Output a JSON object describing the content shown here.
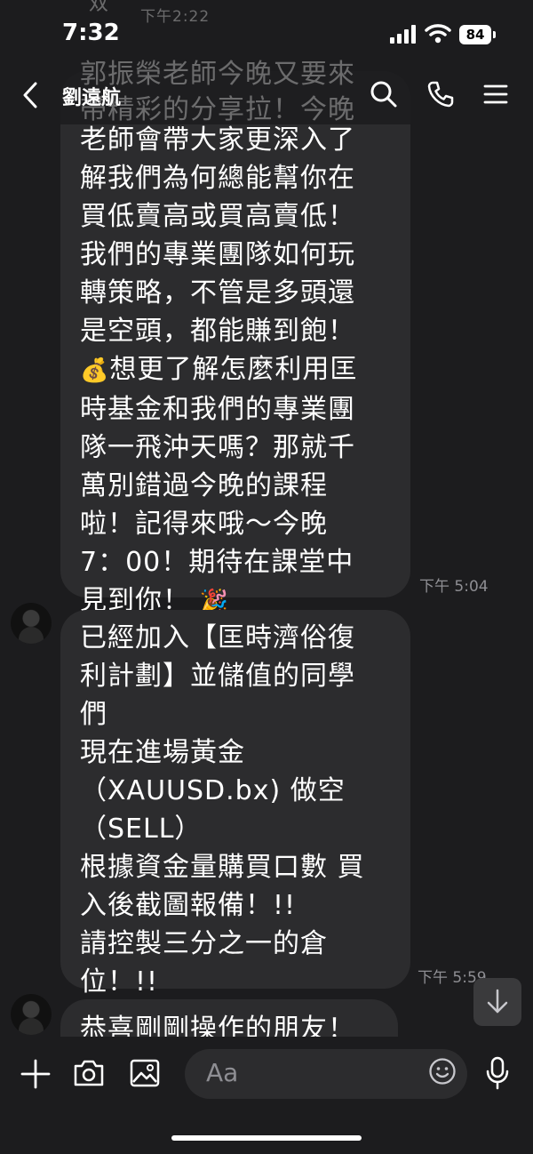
{
  "status_bar": {
    "time": "7:32",
    "battery": "84"
  },
  "header": {
    "title": "劉遠航",
    "overlay_text_1": "郭振榮老師今晚又要來",
    "overlay_text_2": "帶精彩的分享拉！今晚",
    "overlay_top_time": "下午2:22",
    "overlay_top_name": "双"
  },
  "messages": [
    {
      "text_before_emoji": "老師會帶大家更深入了\n解我們為何總能幫你在\n買低賣高或買高賣低！\n我們的專業團隊如何玩\n轉策略，不管是多頭還\n是空頭，都能賺到飽！\n",
      "emoji_1": "💰",
      "text_after_emoji": "想更了解怎麼利用匡\n時基金和我們的專業團\n隊一飛沖天嗎？那就千\n萬別錯過今晚的課程\n啦！記得來哦～今晚\n7：00！期待在課堂中\n見到你！",
      "emoji_2": "🎉",
      "time": "下午 5:04"
    },
    {
      "text": "已經加入【匡時濟俗復\n利計劃】並儲值的同學\n們\n現在進場黃金\n（XAUUSD.bx) 做空\n（SELL）\n根據資金量購買口數 買\n入後截圖報備！!!\n請控製三分之一的倉\n位！!!",
      "time": "下午 5:59"
    },
    {
      "text": "恭喜剛剛操作的朋友！"
    }
  ],
  "input": {
    "placeholder": "Aa"
  },
  "icons": {
    "back": "back-chevron-icon",
    "search": "search-icon",
    "call": "phone-icon",
    "menu": "menu-icon",
    "plus": "plus-icon",
    "camera": "camera-icon",
    "image": "image-icon",
    "emoji": "emoji-icon",
    "mic": "microphone-icon",
    "scroll_down": "arrow-down-icon"
  }
}
